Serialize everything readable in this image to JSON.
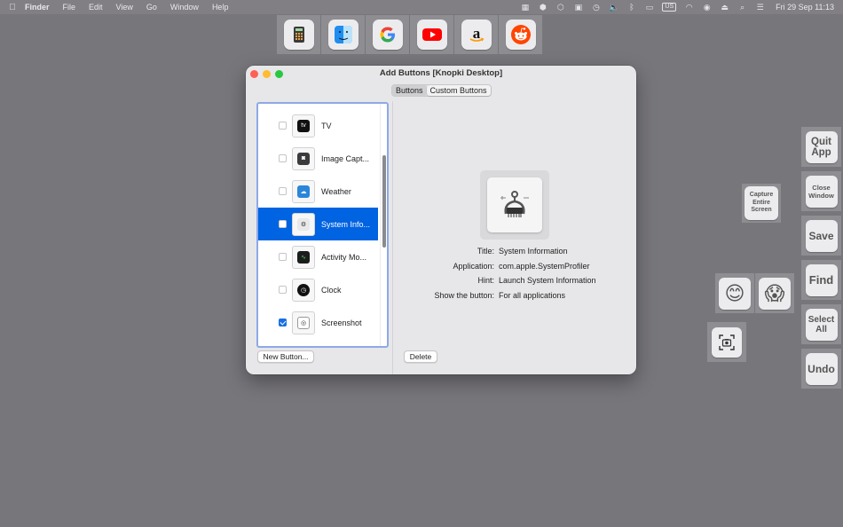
{
  "menubar": {
    "apple_icon": "apple-logo-icon",
    "items": [
      "Finder",
      "File",
      "Edit",
      "View",
      "Go",
      "Window",
      "Help"
    ],
    "keyboard_layout": "US",
    "datetime": "Fri 29 Sep  11:13"
  },
  "topbar": {
    "buttons": [
      {
        "name": "calculator-icon"
      },
      {
        "name": "finder-icon"
      },
      {
        "name": "google-icon"
      },
      {
        "name": "youtube-icon"
      },
      {
        "name": "amazon-icon"
      },
      {
        "name": "reddit-icon"
      }
    ]
  },
  "window": {
    "title": "Add Buttons [Knopki Desktop]",
    "tabs": [
      "Buttons",
      "Custom Buttons"
    ],
    "list": [
      {
        "label": "TV",
        "checked": false,
        "icon": "tv-app-icon"
      },
      {
        "label": "Image Capt...",
        "checked": false,
        "icon": "image-capture-icon"
      },
      {
        "label": "Weather",
        "checked": false,
        "icon": "weather-icon"
      },
      {
        "label": "System Info...",
        "checked": false,
        "icon": "system-information-icon",
        "selected": true
      },
      {
        "label": "Activity Mo...",
        "checked": false,
        "icon": "activity-monitor-icon"
      },
      {
        "label": "Clock",
        "checked": false,
        "icon": "clock-icon"
      },
      {
        "label": "Screenshot",
        "checked": true,
        "icon": "screenshot-icon"
      }
    ],
    "new_button": "New Button...",
    "delete_button": "Delete",
    "details": {
      "title_label": "Title:",
      "title_value": "System Information",
      "app_label": "Application:",
      "app_value": "com.apple.SystemProfiler",
      "hint_label": "Hint:",
      "hint_value": "Launch System Information",
      "show_label": "Show the button:",
      "show_value": "For all applications"
    }
  },
  "floating": {
    "capture": "Capture Entire Screen",
    "quit": "Quit App",
    "close_window": "Close Window",
    "save": "Save",
    "find": "Find",
    "select_all": "Select All",
    "undo": "Undo",
    "emoji_smile": "😊",
    "emoji_scream": "😱"
  }
}
